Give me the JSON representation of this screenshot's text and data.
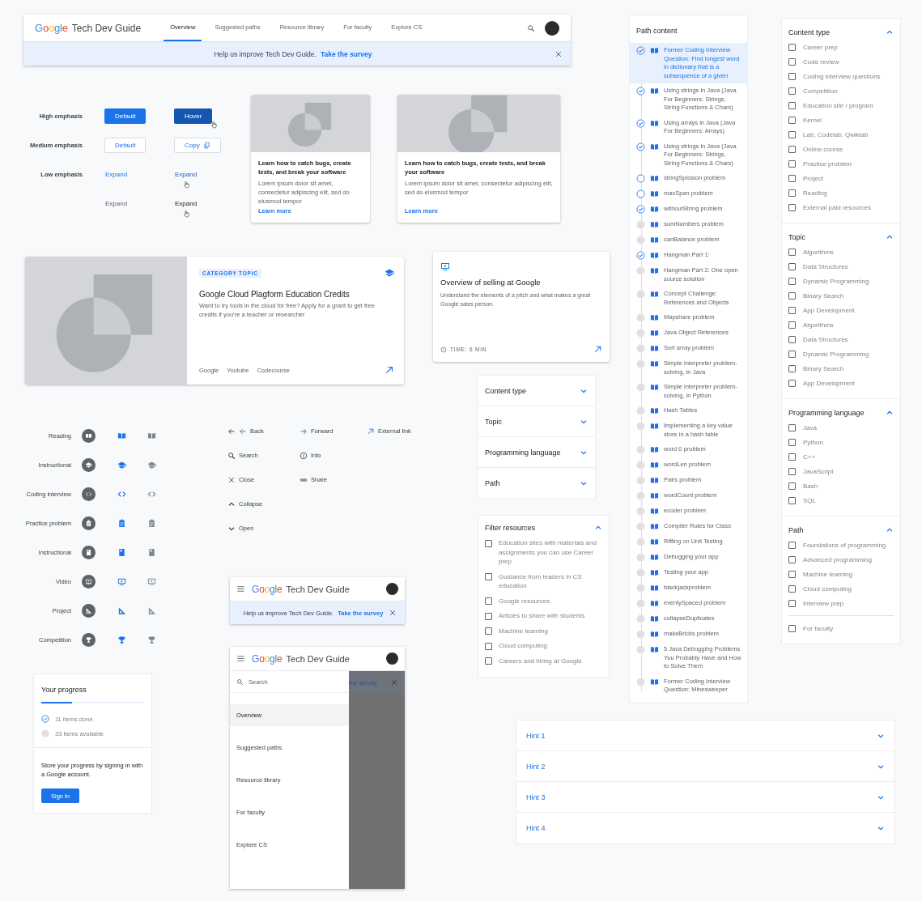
{
  "header": {
    "logo": "Google",
    "title": "Tech Dev Guide",
    "nav": [
      {
        "label": "Overview",
        "selected": true
      },
      {
        "label": "Suggested paths",
        "selected": false
      },
      {
        "label": "Resource library",
        "selected": false
      },
      {
        "label": "For faculty",
        "selected": false
      },
      {
        "label": "Explore CS",
        "selected": false
      }
    ],
    "banner": {
      "text": "Help us improve Tech Dev Guide.",
      "link": "Take the survey"
    }
  },
  "button_styles": [
    {
      "label": "High emphasis",
      "buttons": [
        {
          "label": "Default",
          "kind": "filled",
          "hover": false
        },
        {
          "label": "Hover",
          "kind": "filled",
          "hover": true
        }
      ]
    },
    {
      "label": "Medium emphasis",
      "buttons": [
        {
          "label": "Default",
          "kind": "outlined",
          "hover": false
        },
        {
          "label": "Copy",
          "kind": "outlined-copy",
          "hover": false
        }
      ]
    },
    {
      "label": "Low emphasis",
      "buttons": [
        {
          "label": "Expand",
          "kind": "text-blue",
          "hover": false
        },
        {
          "label": "Expand",
          "kind": "text-blue",
          "hover": true
        }
      ]
    },
    {
      "buttons": [
        {
          "label": "Expand",
          "kind": "text-grey",
          "hover": false
        },
        {
          "label": "Expand",
          "kind": "text-grey",
          "hover": true
        }
      ]
    }
  ],
  "cards": [
    {
      "title": "Learn how to catch bugs, create tests, and break your software",
      "body": "Lorem ipsum dolor sit amet, consectetur adipiscing elit, sed do eiusmod tempor",
      "link": "Learn more"
    },
    {
      "title": "Learn how to catch bugs, create tests, and break your software",
      "body": "Lorem ipsum dolor sit amet, consectetur adipiscing elit, sed do eiusmod tempor",
      "link": "Learn more"
    }
  ],
  "feature_card": {
    "tag": "CATEGORY TOPIC",
    "title": "Google Cloud Plagform Education Credits",
    "body": "Want to try tools in the cloud for free? Apply for a grant to get free credits if you’re a teacher or researcher",
    "sources": [
      "Google",
      "Youtube",
      "Codecourse"
    ]
  },
  "video_card": {
    "title": "Overview of selling at Google",
    "body": "Understand the elements of a pitch and what makes a great Google sales person.",
    "time": "TIME: 6 MIN"
  },
  "content_icons": [
    {
      "label": "Reading",
      "kind": "book"
    },
    {
      "label": "Instructional",
      "kind": "cap"
    },
    {
      "label": "Coding interview",
      "kind": "code"
    },
    {
      "label": "Practice problem",
      "kind": "clipboard"
    },
    {
      "label": "Instructional",
      "kind": "booklet"
    },
    {
      "label": "Video",
      "kind": "video"
    },
    {
      "label": "Project",
      "kind": "project"
    },
    {
      "label": "Competition",
      "kind": "trophy"
    }
  ],
  "ui_icons": [
    [
      {
        "label": "Back",
        "kind": "back"
      },
      {
        "label": "Search",
        "kind": "search"
      },
      {
        "label": "Close",
        "kind": "close"
      },
      {
        "label": "Collapse",
        "kind": "up"
      },
      {
        "label": "Open",
        "kind": "down"
      }
    ],
    [
      {
        "label": "Forward",
        "kind": "forward"
      },
      {
        "label": "Info",
        "kind": "info"
      },
      {
        "label": "Share",
        "kind": "link"
      }
    ],
    [
      {
        "label": "External link",
        "kind": "external"
      }
    ]
  ],
  "accordion": [
    {
      "label": "Content type",
      "expanded": false
    },
    {
      "label": "Topic",
      "expanded": false
    },
    {
      "label": "Programming language",
      "expanded": false
    },
    {
      "label": "Path",
      "expanded": false
    }
  ],
  "filter_resources": {
    "title": "Filter resources",
    "expanded": true,
    "options": [
      {
        "label": "Education sites with materials and assignments you can use Career prep",
        "checked": false
      },
      {
        "label": "Guidance from leaders in CS education",
        "checked": false
      },
      {
        "label": "Google resources",
        "checked": false
      },
      {
        "label": "Articles to share with students",
        "checked": false
      },
      {
        "label": "Machine learning",
        "checked": false
      },
      {
        "label": "Cloud computing",
        "checked": false
      },
      {
        "label": "Careers and hiring at Google",
        "checked": false
      }
    ]
  },
  "path_content": {
    "title": "Path content",
    "items": [
      {
        "label": "Former Coding Interview Question: Find longest word in dictionary that is a subsequence of a given",
        "kind": "done",
        "selected": true
      },
      {
        "label": "Using strings in Java (Java For Beginners: Strings, String Functions & Chars)",
        "kind": "done",
        "selected": false
      },
      {
        "label": "Using arrays in Java (Java For Beginners: Arrays)",
        "kind": "done",
        "selected": false
      },
      {
        "label": "Using strings in Java (Java For Beginners: Strings, String Functions & Chars)",
        "kind": "done",
        "selected": false
      },
      {
        "label": "stringSplosion problem",
        "kind": "open",
        "selected": false
      },
      {
        "label": "maxSpan problem",
        "kind": "open",
        "selected": false
      },
      {
        "label": "withoutString problem",
        "kind": "done",
        "selected": false
      },
      {
        "label": "sumNumbers problem",
        "kind": "locked",
        "selected": false
      },
      {
        "label": "canBalance problem",
        "kind": "locked",
        "selected": false
      },
      {
        "label": "Hangman Part 1:",
        "kind": "done",
        "selected": false
      },
      {
        "label": "Hangman Part 2: One open source solution",
        "kind": "locked",
        "selected": false
      },
      {
        "label": "Concept Challenge: References and Objects",
        "kind": "locked",
        "selected": false
      },
      {
        "label": "Mapshare problem",
        "kind": "locked",
        "selected": false
      },
      {
        "label": "Java Object References",
        "kind": "locked",
        "selected": false
      },
      {
        "label": "Sort array problem",
        "kind": "locked",
        "selected": false
      },
      {
        "label": "Simple interpreter problem-solving, in Java",
        "kind": "locked",
        "selected": false
      },
      {
        "label": "Simple interpreter problem-solving, in Python",
        "kind": "locked",
        "selected": false
      },
      {
        "label": "Hash Tables",
        "kind": "locked",
        "selected": false
      },
      {
        "label": "Implementing a key value store in a hash table",
        "kind": "locked",
        "selected": false
      },
      {
        "label": "word 0 problem",
        "kind": "locked",
        "selected": false
      },
      {
        "label": "wordLen problem",
        "kind": "locked",
        "selected": false
      },
      {
        "label": "Pairs problem",
        "kind": "locked",
        "selected": false
      },
      {
        "label": "wordCount problem",
        "kind": "locked",
        "selected": false
      },
      {
        "label": "ecoder problem",
        "kind": "locked",
        "selected": false
      },
      {
        "label": "Compiler Rules for Class",
        "kind": "locked",
        "selected": false
      },
      {
        "label": "Riffing on Unit Testing",
        "kind": "locked",
        "selected": false
      },
      {
        "label": "Debugging your app",
        "kind": "locked",
        "selected": false
      },
      {
        "label": "Testing your app",
        "kind": "locked",
        "selected": false
      },
      {
        "label": "blackjackproblem",
        "kind": "locked",
        "selected": false
      },
      {
        "label": "evenlySpaced problem",
        "kind": "locked",
        "selected": false
      },
      {
        "label": "collapseDuplicates",
        "kind": "locked",
        "selected": false
      },
      {
        "label": "makeBricks problem",
        "kind": "locked",
        "selected": false
      },
      {
        "label": "5 Java Debugging Problems You Probably Have and How to Solve Them",
        "kind": "locked",
        "selected": false
      },
      {
        "label": "Former Coding Interview Question: Minesweeper",
        "kind": "locked",
        "selected": false
      }
    ]
  },
  "filters": [
    {
      "title": "Content type",
      "expanded": true,
      "option_groups": [
        [
          {
            "label": "Career prep",
            "checked": false
          },
          {
            "label": "Code review",
            "checked": false
          },
          {
            "label": "Coding interview questions",
            "checked": false
          },
          {
            "label": "Competition",
            "checked": false
          },
          {
            "label": "Education site / program",
            "checked": false
          },
          {
            "label": "Kernel",
            "checked": false
          },
          {
            "label": "Lab, Codelab, Qwiklab",
            "checked": false
          },
          {
            "label": "Online course",
            "checked": false
          },
          {
            "label": "Practice problem",
            "checked": false
          },
          {
            "label": "Project",
            "checked": false
          },
          {
            "label": "Reading",
            "checked": false
          },
          {
            "label": "External paid resources",
            "checked": false
          }
        ]
      ]
    },
    {
      "title": "Topic",
      "expanded": true,
      "option_groups": [
        [
          {
            "label": "Algorithms",
            "checked": false
          },
          {
            "label": "Data Structures",
            "checked": false
          },
          {
            "label": "Dynamic Programming",
            "checked": false
          },
          {
            "label": "Binary Search",
            "checked": false
          },
          {
            "label": "App Development",
            "checked": false
          },
          {
            "label": "Algorithms",
            "checked": false
          },
          {
            "label": "Data Structures",
            "checked": false
          },
          {
            "label": "Dynamic Programming",
            "checked": false
          },
          {
            "label": "Binary Search",
            "checked": false
          },
          {
            "label": "App Development",
            "checked": false
          }
        ]
      ]
    },
    {
      "title": "Programming language",
      "expanded": true,
      "option_groups": [
        [
          {
            "label": "Java",
            "checked": false
          },
          {
            "label": "Python",
            "checked": false
          },
          {
            "label": "C++",
            "checked": false
          },
          {
            "label": "JavaScript",
            "checked": false
          },
          {
            "label": "Bash",
            "checked": false
          },
          {
            "label": "SQL",
            "checked": false
          }
        ]
      ]
    },
    {
      "title": "Path",
      "expanded": true,
      "option_groups": [
        [
          {
            "label": "Foundations of programming",
            "checked": false
          },
          {
            "label": "Advanced programming",
            "checked": false
          },
          {
            "label": "Machine learning",
            "checked": false
          },
          {
            "label": "Cloud computing",
            "checked": false
          },
          {
            "label": "Interview prep",
            "checked": false
          }
        ],
        [
          {
            "label": "For faculty",
            "checked": false
          }
        ]
      ]
    }
  ],
  "mobile_header": {
    "logo": "Google",
    "title": "Tech Dev Guide",
    "banner": {
      "text": "Help us improve Tech Dev Guide.",
      "link": "Take the survey"
    }
  },
  "mobile_menu": {
    "logo": "Google",
    "title": "Tech Dev Guide",
    "search": {
      "placeholder": "Search"
    },
    "banner_link": "the survey",
    "items": [
      {
        "label": "Overview",
        "selected": true
      },
      {
        "label": "Suggested paths",
        "selected": false
      },
      {
        "label": "Resource library",
        "selected": false
      },
      {
        "label": "For faculty",
        "selected": false
      },
      {
        "label": "Explore CS",
        "selected": false
      }
    ]
  },
  "progress": {
    "title": "Your progress",
    "level": 0.3,
    "done": "11 items done",
    "available": "33 items available",
    "prompt": "Store your progress by signing in with a Google account.",
    "button": "Sign in"
  },
  "hints": [
    {
      "label": "Hint 1",
      "expanded": false
    },
    {
      "label": "Hint 2",
      "expanded": false
    },
    {
      "label": "Hint 3",
      "expanded": false
    },
    {
      "label": "Hint 4",
      "expanded": false
    }
  ]
}
